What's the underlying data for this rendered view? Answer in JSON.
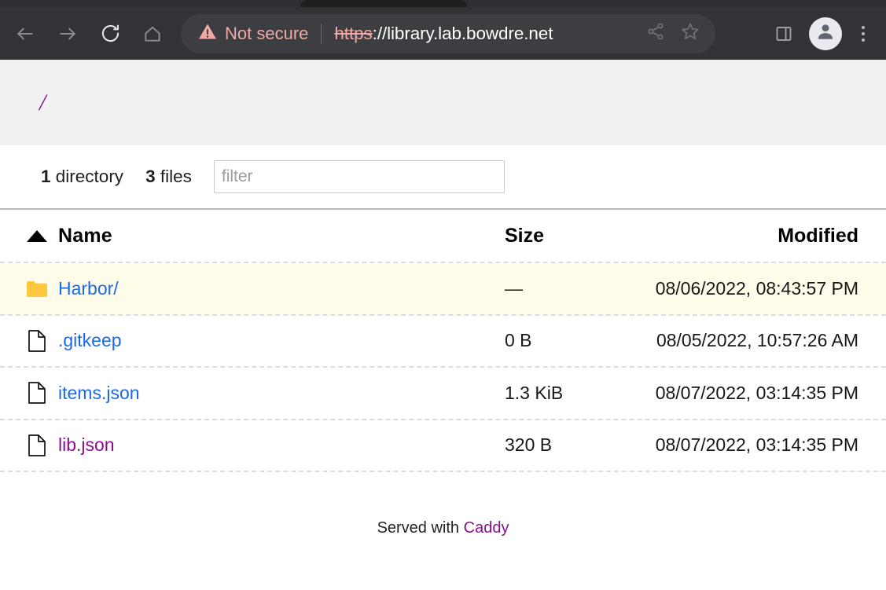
{
  "browser": {
    "nav": {
      "back_icon": "arrow-left-icon",
      "forward_icon": "arrow-right-icon",
      "reload_icon": "reload-icon",
      "home_icon": "home-icon"
    },
    "omnibox": {
      "warning_icon": "warning-triangle-icon",
      "security_label": "Not secure",
      "url_scheme": "https",
      "url_rest": "://library.lab.bowdre.net",
      "share_icon": "share-icon",
      "bookmark_icon": "star-icon"
    },
    "toolbar_right": {
      "side_panel_icon": "side-panel-icon",
      "profile_icon": "profile-avatar-icon",
      "menu_icon": "three-dot-menu-icon"
    },
    "colors": {
      "chrome_bg": "#323337",
      "omnibox_bg": "#3d3e42",
      "insecure_text": "#f0a9a5"
    }
  },
  "page": {
    "breadcrumb": "/",
    "stats": {
      "dir_count": "1",
      "dir_label": "directory",
      "file_count": "3",
      "file_label": "files"
    },
    "filter": {
      "placeholder": "filter",
      "value": ""
    },
    "table": {
      "headers": {
        "name": "Name",
        "size": "Size",
        "modified": "Modified"
      },
      "sort_icon": "sort-ascending-caret-icon",
      "rows": [
        {
          "icon": "folder-icon",
          "name": "Harbor/",
          "size": "—",
          "modified": "08/06/2022, 08:43:57 PM",
          "link_state": "unvisited",
          "highlighted": true
        },
        {
          "icon": "file-icon",
          "name": ".gitkeep",
          "size": "0 B",
          "modified": "08/05/2022, 10:57:26 AM",
          "link_state": "unvisited",
          "highlighted": false
        },
        {
          "icon": "file-icon",
          "name": "items.json",
          "size": "1.3 KiB",
          "modified": "08/07/2022, 03:14:35 PM",
          "link_state": "unvisited",
          "highlighted": false
        },
        {
          "icon": "file-icon",
          "name": "lib.json",
          "size": "320 B",
          "modified": "08/07/2022, 03:14:35 PM",
          "link_state": "visited",
          "highlighted": false
        }
      ]
    },
    "footer": {
      "text": "Served with",
      "link": "Caddy"
    },
    "colors": {
      "header_bg": "#f1f1f1",
      "highlight_row": "#fffdea",
      "link": "#1a6ae8",
      "visited_link": "#8a0f8a",
      "folder_icon": "#ffc83d"
    }
  }
}
